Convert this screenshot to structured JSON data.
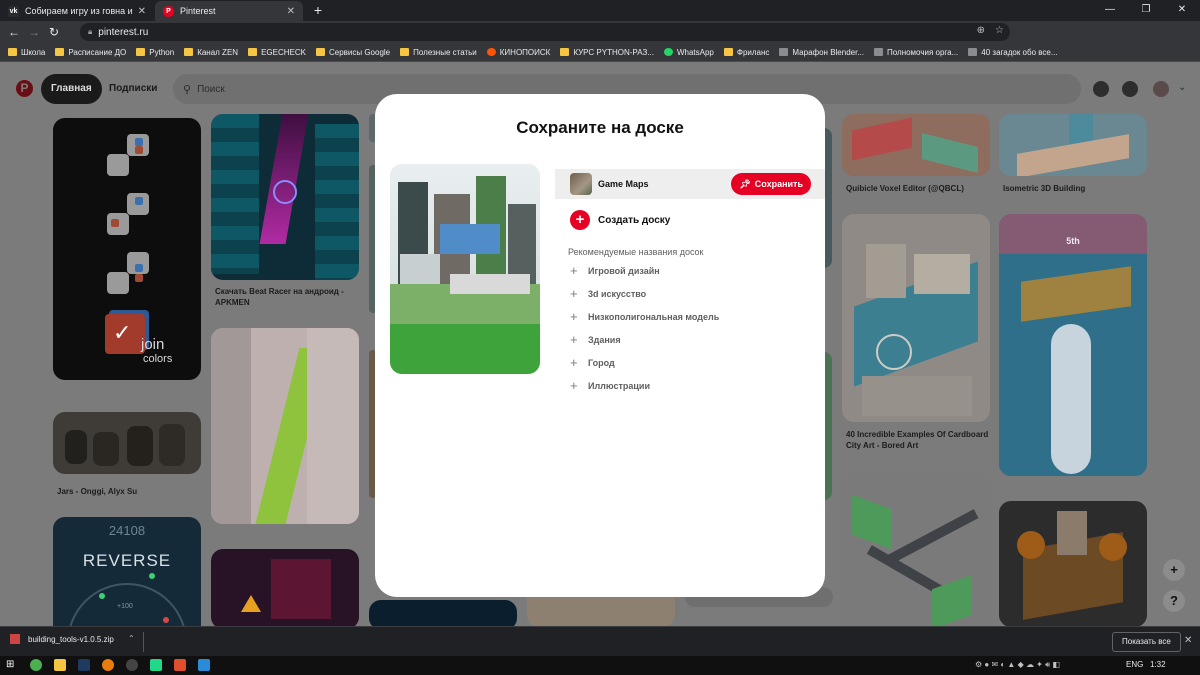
{
  "browser": {
    "tabs": [
      {
        "title": "Собираем игру из говна и палок",
        "favicon": "VK",
        "active": false
      },
      {
        "title": "Pinterest",
        "favicon": "P",
        "active": true
      }
    ],
    "url": "pinterest.ru",
    "bookmarks": [
      {
        "label": "Школа",
        "icon": "folder-icon"
      },
      {
        "label": "Расписание ДО",
        "icon": "folder-icon"
      },
      {
        "label": "Python",
        "icon": "folder-icon"
      },
      {
        "label": "Канал ZEN",
        "icon": "folder-icon"
      },
      {
        "label": "EGECHECK",
        "icon": "folder-icon"
      },
      {
        "label": "Сервисы Google",
        "icon": "folder-icon"
      },
      {
        "label": "Полезные статьи",
        "icon": "folder-icon"
      },
      {
        "label": "КИНОПОИСК",
        "icon": "kinopoisk-icon"
      },
      {
        "label": "КУРС PYTHON-РАЗ...",
        "icon": "folder-icon"
      },
      {
        "label": "WhatsApp",
        "icon": "whatsapp-icon"
      },
      {
        "label": "Фриланс",
        "icon": "folder-icon"
      },
      {
        "label": "Марафон Blender...",
        "icon": "page-icon"
      },
      {
        "label": "Полномочия орга...",
        "icon": "page-icon"
      },
      {
        "label": "40 загадок обо все...",
        "icon": "page-icon"
      }
    ]
  },
  "pinterest": {
    "nav": {
      "home": "Главная",
      "following": "Подписки"
    },
    "search_placeholder": "Поиск",
    "pins": {
      "beat_racer": "Скачать Beat Racer на андроид - APKMEN",
      "join_colors_text": "join",
      "join_colors_text2": "colors",
      "jars": "Jars - Onggi, Alyx Su",
      "reverse_title": "REVERSE",
      "reverse_score": "24108",
      "reverse_badge": "+100",
      "qubicle": "Quibicle Voxel Editor (@QBCL)",
      "isometric": "Isometric 3D Building",
      "cardboard": "40 Incredible Examples Of Cardboard City Art - Bored Art",
      "race_place": "5th"
    }
  },
  "modal": {
    "title": "Сохраните на доске",
    "board_name": "Game Maps",
    "save_label": "Сохранить",
    "create_board": "Создать доску",
    "recommended_label": "Рекомендуемые названия досок",
    "suggestions": [
      "Игровой дизайн",
      "3d искусство",
      "Низкополигональная модель",
      "Здания",
      "Город",
      "Иллюстрации"
    ]
  },
  "downloads": {
    "file": "building_tools-v1.0.5.zip",
    "show_all": "Показать все"
  },
  "taskbar": {
    "lang": "ENG",
    "time": "1:32"
  },
  "colors": {
    "pinterest_red": "#e60023",
    "overlay": "#7b7b7b"
  }
}
